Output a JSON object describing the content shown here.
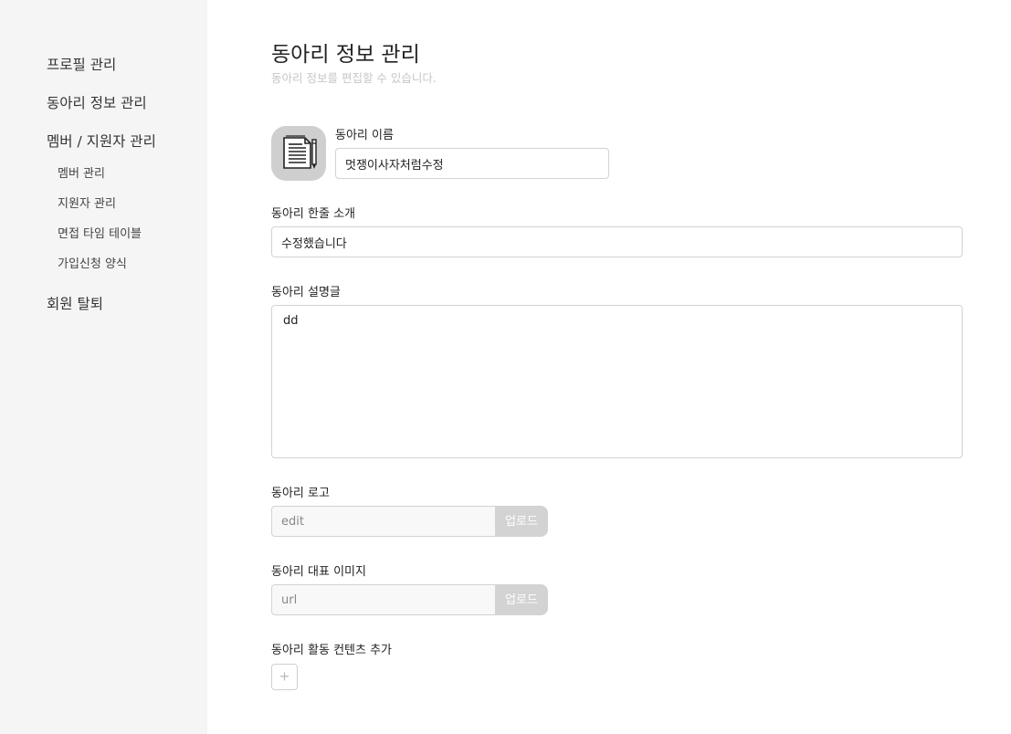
{
  "sidebar": {
    "items": [
      {
        "label": "프로필 관리"
      },
      {
        "label": "동아리 정보 관리"
      },
      {
        "label": "멤버 / 지원자 관리"
      }
    ],
    "sub_items": [
      {
        "label": "멤버 관리"
      },
      {
        "label": "지원자 관리"
      },
      {
        "label": "면접 타임 테이블"
      },
      {
        "label": "가입신청 양식"
      }
    ],
    "withdraw_label": "회원 탈퇴"
  },
  "header": {
    "title": "동아리 정보 관리",
    "subtitle": "동아리 정보를 편집할 수 있습니다."
  },
  "form": {
    "logo_icon": "document-pen-icon",
    "club_name": {
      "label": "동아리 이름",
      "value": "멋쟁이사자처럼수정"
    },
    "one_line_intro": {
      "label": "동아리 한줄 소개",
      "value": "수정했습니다"
    },
    "description": {
      "label": "동아리 설명글",
      "value": "dd"
    },
    "club_logo": {
      "label": "동아리 로고",
      "placeholder": "edit",
      "button_label": "업로드"
    },
    "representative_image": {
      "label": "동아리 대표 이미지",
      "placeholder": "url",
      "button_label": "업로드"
    },
    "activity_content": {
      "label": "동아리 활동 컨텐츠 추가",
      "add_symbol": "+"
    }
  },
  "colors": {
    "sidebar_bg": "#f5f5f5",
    "upload_button_bg": "#d3d3d3",
    "border": "#d3d3d3",
    "subtitle": "#c6c6c6"
  }
}
